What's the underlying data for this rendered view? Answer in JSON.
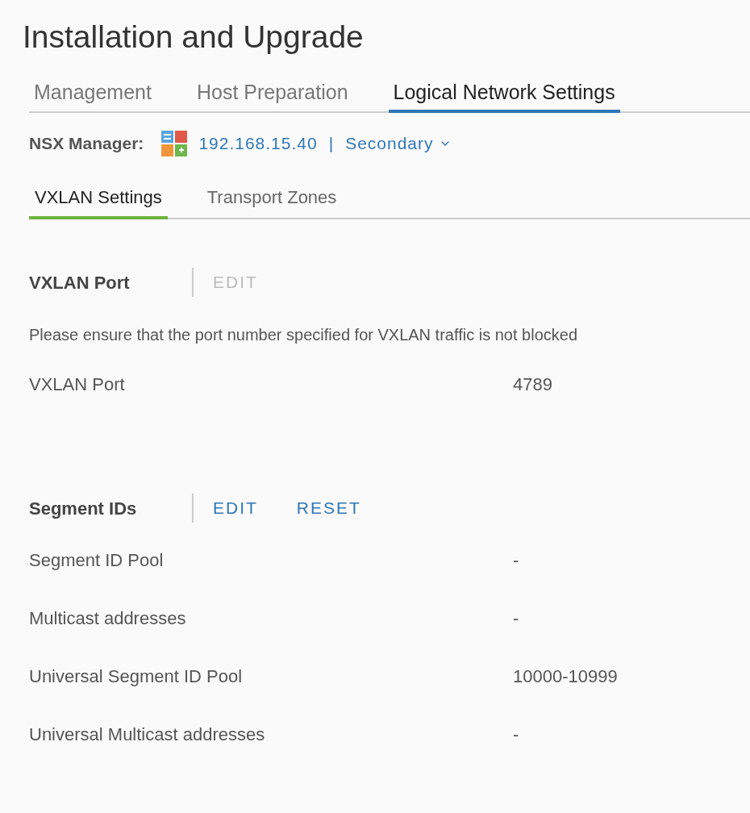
{
  "title": "Installation and Upgrade",
  "tabs": [
    {
      "label": "Management",
      "selected": false
    },
    {
      "label": "Host Preparation",
      "selected": false
    },
    {
      "label": "Logical Network Settings",
      "selected": true
    }
  ],
  "manager": {
    "label": "NSX Manager:",
    "address": "192.168.15.40",
    "separator": "|",
    "role": "Secondary"
  },
  "sub_tabs": [
    {
      "label": "VXLAN Settings",
      "selected": true
    },
    {
      "label": "Transport Zones",
      "selected": false
    }
  ],
  "sections": [
    {
      "title": "VXLAN Port",
      "actions": [
        {
          "label": "EDIT",
          "disabled": true
        }
      ],
      "notice": "Please ensure that the port number specified for VXLAN traffic is not blocked",
      "rows": [
        {
          "label": "VXLAN Port",
          "value": "4789"
        }
      ]
    },
    {
      "title": "Segment IDs",
      "actions": [
        {
          "label": "EDIT",
          "disabled": false
        },
        {
          "label": "RESET",
          "disabled": false
        }
      ],
      "rows": [
        {
          "label": "Segment ID Pool",
          "value": "-"
        },
        {
          "label": "Multicast addresses",
          "value": "-"
        },
        {
          "label": "Universal Segment ID Pool",
          "value": "10000-10999"
        },
        {
          "label": "Universal Multicast addresses",
          "value": "-"
        }
      ]
    }
  ]
}
